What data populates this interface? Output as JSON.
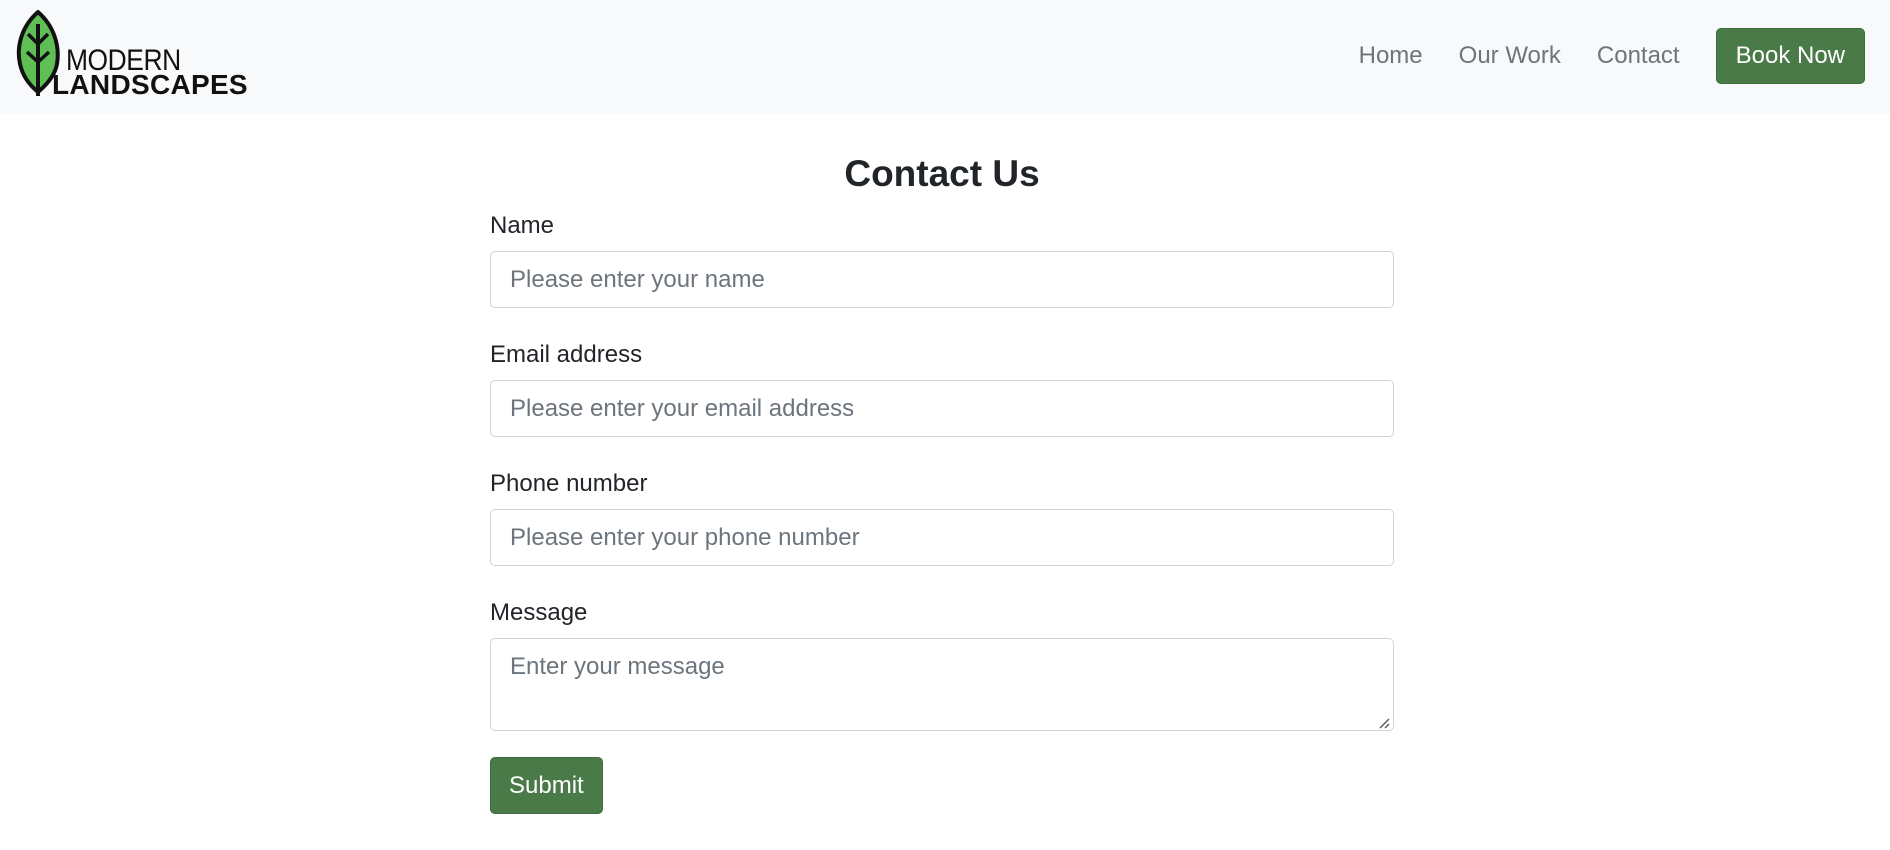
{
  "brand": {
    "logo_line_1": "MODERN",
    "logo_line_2": "LANDSCAPES",
    "logo_icon": "leaf-icon",
    "accent_color": "#4a7a47",
    "leaf_color": "#5fbf55"
  },
  "nav": {
    "items": [
      {
        "label": "Home"
      },
      {
        "label": "Our Work"
      },
      {
        "label": "Contact"
      }
    ],
    "cta_label": "Book Now"
  },
  "form": {
    "title": "Contact Us",
    "fields": [
      {
        "label": "Name",
        "placeholder": "Please enter your name",
        "value": ""
      },
      {
        "label": "Email address",
        "placeholder": "Please enter your email address",
        "value": ""
      },
      {
        "label": "Phone number",
        "placeholder": "Please enter your phone number",
        "value": ""
      }
    ],
    "message": {
      "label": "Message",
      "placeholder": "Enter your message",
      "value": ""
    },
    "submit_label": "Submit"
  }
}
